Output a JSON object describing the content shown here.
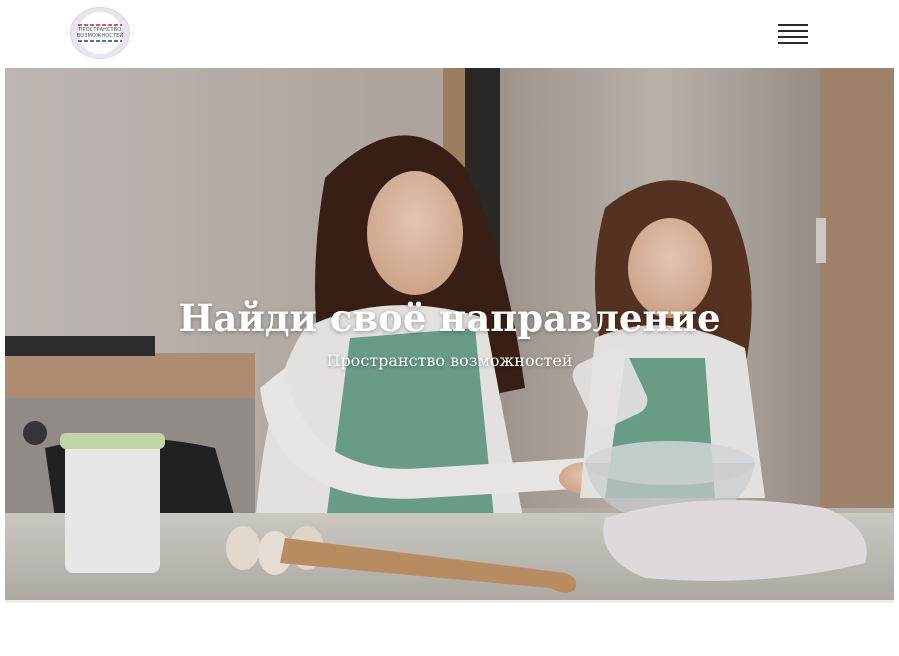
{
  "header": {
    "logo": {
      "text_line1": "ПРОСТРАНСТВО",
      "text_line2": "ВОЗМОЖНОСТЕЙ",
      "colors": {
        "red": "#d35a5a",
        "blue": "#4f6fa8",
        "ring": "#e9e4ee"
      }
    },
    "menu_icon": "hamburger-menu-icon"
  },
  "hero": {
    "title": "Найди своё направление",
    "subtitle": "Пространство возможностей",
    "image_description_icon": "kitchen-photo"
  }
}
